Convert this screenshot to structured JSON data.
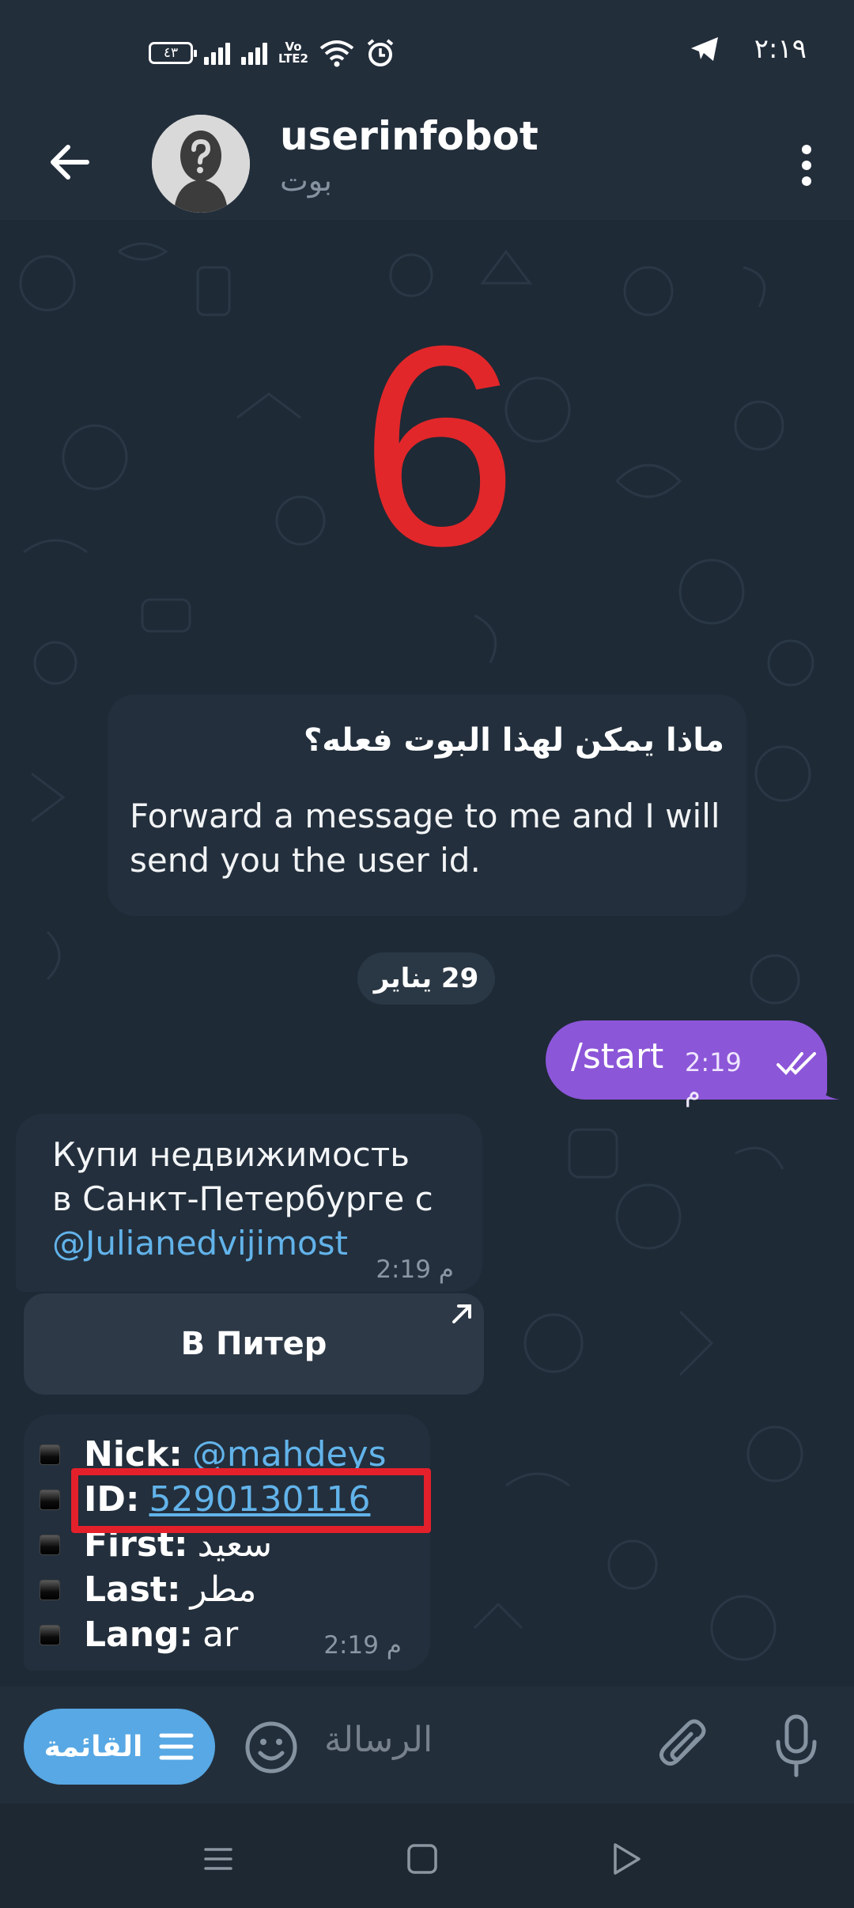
{
  "status_bar": {
    "battery": "٤٣",
    "network_label": "VoLTE2",
    "clock": "٢:١٩"
  },
  "header": {
    "bot_name": "userinfobot",
    "subtitle": "بوت"
  },
  "chat": {
    "overlay_number": "6",
    "intro": {
      "title": "ماذا يمكن لهذا البوت فعله؟",
      "text": "Forward a message to me and I will send you the user id."
    },
    "date_separator": "29 يناير",
    "outgoing": {
      "text": "/start",
      "time": "2:19 م"
    },
    "ad": {
      "line1": "Купи недвижимость",
      "line2": "в Санкт-Петербурге с",
      "link": "@Julianedvijimost",
      "time": "2:19 م"
    },
    "inline_button": "В Питер",
    "info": {
      "rows": [
        {
          "key": "Nick:",
          "value": "@mahdeys"
        },
        {
          "key": "ID:",
          "value": "5290130116"
        },
        {
          "key": "First:",
          "value": "سعيد"
        },
        {
          "key": "Last:",
          "value": "مطر"
        },
        {
          "key": "Lang:",
          "value": "ar"
        }
      ],
      "time": "2:19 م"
    }
  },
  "composer": {
    "menu_label": "القائمة",
    "placeholder": "الرسالة"
  },
  "colors": {
    "accent": "#57a8e4",
    "outgoing_bubble": "#8c56d8",
    "highlight": "#e4202b",
    "link": "#62b3ea"
  }
}
